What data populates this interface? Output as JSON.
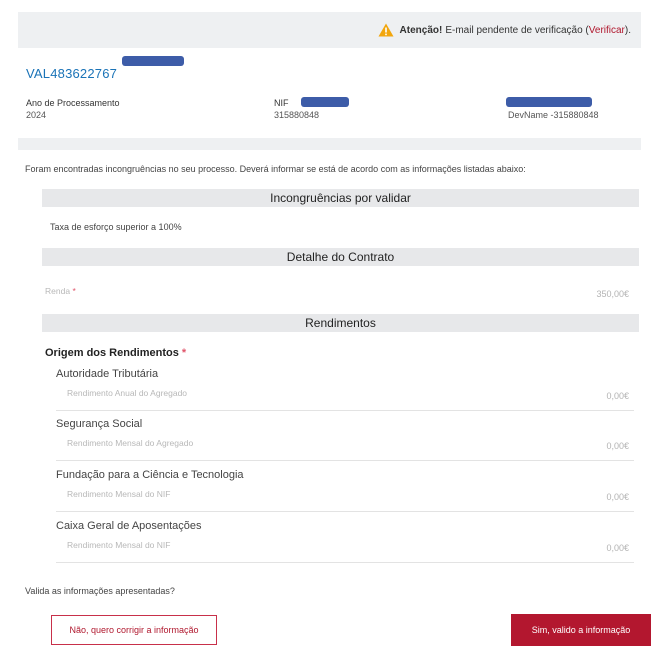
{
  "alert": {
    "strong": "Atenção!",
    "message": " E-mail pendente de verificação (",
    "link": "Verificar",
    "suffix": ")."
  },
  "process": {
    "id": "VAL483622767",
    "year_label": "Ano de Processamento",
    "year_value": "2024",
    "nif_label": "NIF",
    "nif_value": "315880848",
    "devname_value": "DevName -315880848"
  },
  "intro": "Foram encontradas incongruências no seu processo. Deverá informar se está de acordo com as informações listadas abaixo:",
  "sections": {
    "incongruencias": {
      "title": "Incongruências por validar",
      "item": "Taxa de esforço superior a 100%"
    },
    "contrato": {
      "title": "Detalhe do Contrato",
      "renda_label": "Renda",
      "renda_required": "*",
      "renda_value": "350,00€"
    },
    "rendimentos": {
      "title": "Rendimentos",
      "origem_label": "Origem dos Rendimentos",
      "origem_required": "*",
      "sources": [
        {
          "name": "Autoridade Tributária",
          "label": "Rendimento Anual do Agregado",
          "value": "0,00€"
        },
        {
          "name": "Segurança Social",
          "label": "Rendimento Mensal do Agregado",
          "value": "0,00€"
        },
        {
          "name": "Fundação para a Ciência e Tecnologia",
          "label": "Rendimento Mensal do NIF",
          "value": "0,00€"
        },
        {
          "name": "Caixa Geral de Aposentações",
          "label": "Rendimento Mensal do NIF",
          "value": "0,00€"
        }
      ]
    }
  },
  "question": "Valida as informações apresentadas?",
  "buttons": {
    "reject": "Não, quero corrigir a informação",
    "accept": "Sim, valido a informação"
  },
  "colors": {
    "accent_red": "#b3172f",
    "link_blue": "#1a73b7",
    "warning": "#f2a60d",
    "redaction": "#3d5ca8"
  },
  "icons": {
    "alert": "warning-triangle-icon"
  }
}
